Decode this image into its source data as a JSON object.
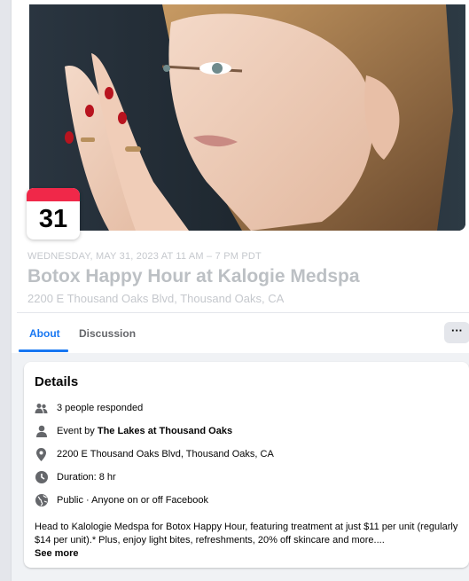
{
  "event": {
    "date_day": "31",
    "when": "WEDNESDAY, MAY 31, 2023 AT 11 AM – 7 PM PDT",
    "title": "Botox Happy Hour at Kalogie Medspa",
    "address": "2200 E Thousand Oaks Blvd, Thousand Oaks, CA"
  },
  "tabs": [
    {
      "label": "About",
      "active": true
    },
    {
      "label": "Discussion",
      "active": false
    }
  ],
  "more_label": "···",
  "details": {
    "title": "Details",
    "responded": "3 people responded",
    "event_by_prefix": "Event by ",
    "event_by_name": "The Lakes at Thousand Oaks",
    "location": "2200 E Thousand Oaks Blvd, Thousand Oaks, CA",
    "duration": "Duration: 8 hr",
    "privacy": "Public · Anyone on or off Facebook",
    "description": "Head to Kalologie Medspa for Botox Happy Hour, featuring treatment at just $11 per unit (regularly $14 per unit).* Plus, enjoy light bites, refreshments, 20% off skincare and more....",
    "see_more": "See more"
  },
  "icons": {
    "responded": "people-icon",
    "host": "person-icon",
    "location": "location-pin-icon",
    "duration": "clock-icon",
    "privacy": "globe-icon"
  },
  "colors": {
    "accent": "#1877f2",
    "calendar_red": "#f02849",
    "icon_gray": "#65676b"
  }
}
